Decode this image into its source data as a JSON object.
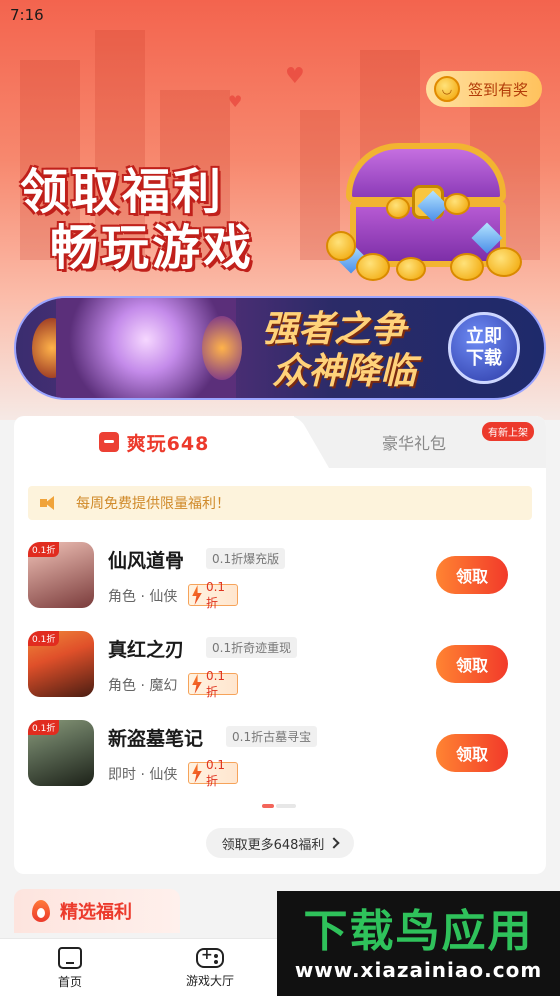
{
  "status_bar": {
    "time": "7:16"
  },
  "hero": {
    "checkin_label": "签到有奖",
    "slogan_line1": "领取福利",
    "slogan_line2": "畅玩游戏"
  },
  "game_banner": {
    "title_line1": "强者之争",
    "title_line2": "众神降临",
    "download_line1": "立即",
    "download_line2": "下载"
  },
  "tabs": {
    "active": "爽玩648",
    "inactive": "豪华礼包",
    "badge": "有新上架"
  },
  "notice": "每周免费提供限量福利！",
  "games": [
    {
      "tag": "0.1折",
      "name": "仙风道骨",
      "subtitle": "0.1折爆充版",
      "genre": "角色 · 仙侠",
      "discount": "0.1折",
      "button": "领取",
      "icon_colors": [
        "#f1c3b8",
        "#7a3b3b"
      ]
    },
    {
      "tag": "0.1折",
      "name": "真红之刃",
      "subtitle": "0.1折奇迹重现",
      "genre": "角色 · 魔幻",
      "discount": "0.1折",
      "button": "领取",
      "icon_colors": [
        "#e0502a",
        "#4a1d12"
      ]
    },
    {
      "tag": "0.1折",
      "name": "新盗墓笔记",
      "subtitle": "0.1折古墓寻宝",
      "genre": "即时 · 仙侠",
      "discount": "0.1折",
      "button": "领取",
      "icon_colors": [
        "#5c6a55",
        "#1c2118"
      ]
    }
  ],
  "more_button": "领取更多648福利",
  "section_tab": "精选福利",
  "bottom_nav": [
    {
      "label": "首页",
      "icon": "home-icon"
    },
    {
      "label": "游戏大厅",
      "icon": "gamepad-icon"
    }
  ],
  "watermark": {
    "main": "下载鸟应用",
    "url": "www.xiazainiao.com"
  }
}
